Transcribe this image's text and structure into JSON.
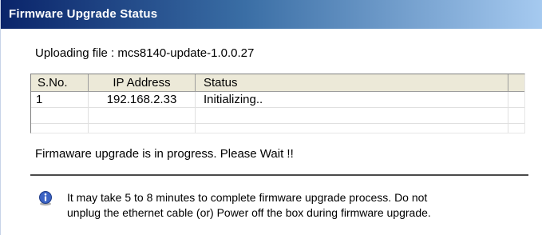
{
  "window": {
    "title": "Firmware Upgrade Status"
  },
  "upload": {
    "text": "Uploading file : mcs8140-update-1.0.0.27"
  },
  "table": {
    "columns": [
      "S.No.",
      "IP Address",
      "Status"
    ],
    "rows": [
      {
        "sno": "1",
        "ip": "192.168.2.33",
        "status": "Initializing.."
      }
    ]
  },
  "progress": {
    "message": "Firmaware upgrade is in progress. Please Wait !!"
  },
  "note": {
    "icon": "info-icon",
    "line1": "It may take 5 to 8 minutes to complete firmware upgrade process. Do not",
    "line2": "unplug the ethernet cable (or) Power off the box during firmware upgrade."
  },
  "colors": {
    "titlebar_start": "#0a246a",
    "titlebar_end": "#a6caf0",
    "header_bg": "#ece9d8"
  }
}
